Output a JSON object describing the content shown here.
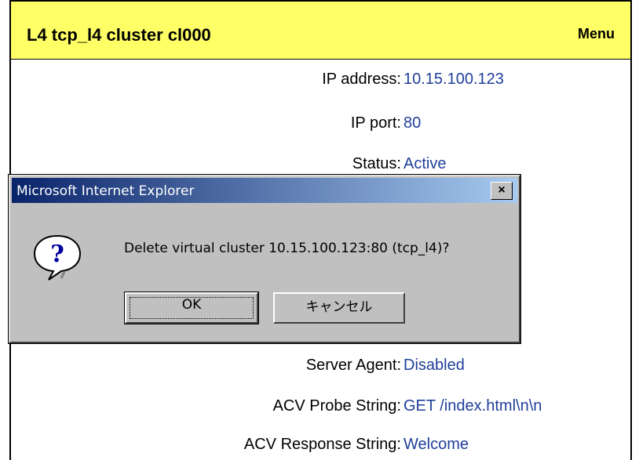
{
  "page": {
    "title": "L4 tcp_l4 cluster cl000",
    "menu_label": "Menu"
  },
  "fields": [
    {
      "label": "IP address:",
      "value": "10.15.100.123"
    },
    {
      "label": "IP port:",
      "value": "80"
    },
    {
      "label": "Status:",
      "value": "Active"
    },
    {
      "label": "Server Agent:",
      "value": "Disabled"
    },
    {
      "label": "ACV Probe String:",
      "value": "GET /index.html\\n\\n"
    },
    {
      "label": "ACV Response String:",
      "value": "Welcome"
    }
  ],
  "dialog": {
    "title": "Microsoft Internet Explorer",
    "close_label": "×",
    "message": "Delete  virtual cluster 10.15.100.123:80 (tcp_l4)?",
    "ok_label": "OK",
    "cancel_label": "キャンセル",
    "icon": "question-icon"
  },
  "colors": {
    "header_bg": "#ffff66",
    "value_text": "#1f3f99",
    "dialog_title_start": "#0a246a",
    "dialog_bg": "#c0c0c0"
  }
}
